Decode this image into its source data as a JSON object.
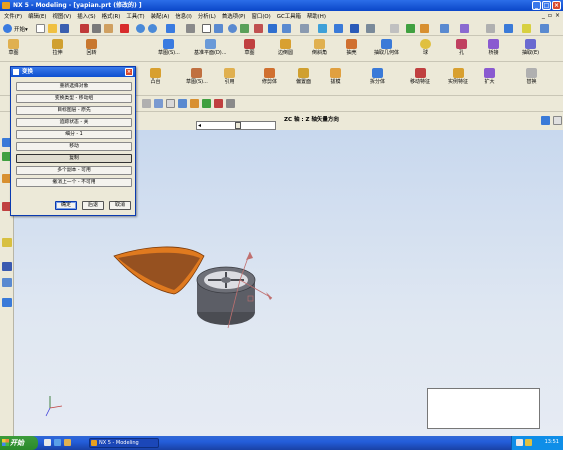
{
  "window": {
    "title": "NX 5 - Modeling - [yapian.prt  (修改的) ]"
  },
  "menubar": {
    "items": [
      "文件(F)",
      "编辑(E)",
      "视图(V)",
      "插入(S)",
      "格式(R)",
      "工具(T)",
      "装配(A)",
      "信息(I)",
      "分析(L)",
      "首选项(P)",
      "窗口(O)",
      "GC工具箱",
      "帮助(H)"
    ]
  },
  "toolbar1": {
    "start_label": "开始▾"
  },
  "toolbar2": {
    "items": [
      "草图",
      "拉伸",
      "回转",
      "草图(S)...",
      "基准平面(D)...",
      "草图",
      "边倒圆",
      "倒斜角",
      "抽壳",
      "抽取几何体",
      "球",
      "孔",
      "桥接",
      "抽取(E)"
    ]
  },
  "toolbar3": {
    "items": [
      "凸台",
      "腔体",
      "垫块",
      "键槽",
      "槽",
      "三角形加强筋",
      "螺纹",
      "阵列",
      "镜像特征",
      "实例特征",
      "修剪体",
      "缝合",
      "偏置面",
      "拔模",
      "边倒圆",
      "倒斜角",
      "抽壳",
      "移动面",
      "扩大",
      "替换"
    ]
  },
  "toolbar3_labels": {
    "a": "引用",
    "b": "修剪体",
    "c": "实例特征",
    "d": "变换",
    "e": "形成特征",
    "f": "偏置面",
    "g": "拔模",
    "h": "面向特征",
    "i": "连接面",
    "j": "移动特征",
    "k": "抽取面",
    "l": "组合体",
    "m": "拆分体",
    "n": "替换"
  },
  "prompt": {
    "text": "ZC 轴 : Z 轴矢量方向"
  },
  "dialog": {
    "title": "变换",
    "buttons": [
      "重新选择对象",
      "变换类型 - 移动组",
      "目标图层 - 原先",
      "追踪状态 - 关",
      "细分 - 1",
      "移动",
      "复制",
      "多个副本 - 可用",
      "撤消上一个 - 不可用"
    ],
    "ok": "确定",
    "back": "后退",
    "cancel": "取消"
  },
  "taskbar": {
    "start": "开始",
    "task": "NX 5 - Modeling",
    "clock": "13:51"
  },
  "colors": {
    "titlebar": "#0a46c8",
    "viewport_top": "#c8d8ee",
    "sheet": "#e07a1f",
    "cylinder": "#585a62"
  }
}
